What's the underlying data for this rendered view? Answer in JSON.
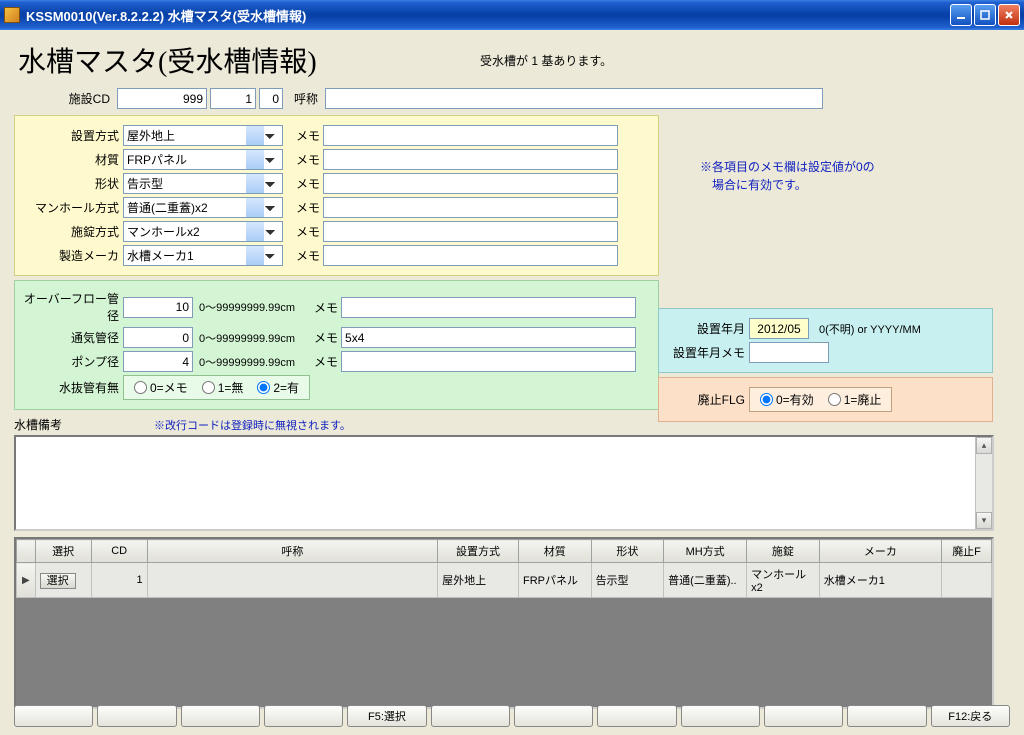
{
  "window": {
    "title": "KSSM0010(Ver.8.2.2.2) 水槽マスタ(受水槽情報)"
  },
  "page": {
    "heading": "水槽マスタ(受水槽情報)",
    "status": "受水槽が 1 基あります。"
  },
  "head": {
    "facility_cd_lbl": "施設CD",
    "facility_cd": "999",
    "sub1": "1",
    "sub2": "0",
    "name_lbl": "呼称",
    "name": ""
  },
  "note": {
    "line1": "※各項目のメモ欄は設定値が0の",
    "line2": "　場合に有効です。"
  },
  "yellow": {
    "rows": [
      {
        "label": "設置方式",
        "value": "屋外地上",
        "memo_lbl": "メモ",
        "memo": ""
      },
      {
        "label": "材質",
        "value": "FRPパネル",
        "memo_lbl": "メモ",
        "memo": ""
      },
      {
        "label": "形状",
        "value": "告示型",
        "memo_lbl": "メモ",
        "memo": ""
      },
      {
        "label": "マンホール方式",
        "value": "普通(二重蓋)x2",
        "memo_lbl": "メモ",
        "memo": ""
      },
      {
        "label": "施錠方式",
        "value": "マンホールx2",
        "memo_lbl": "メモ",
        "memo": ""
      },
      {
        "label": "製造メーカ",
        "value": "水槽メーカ1",
        "memo_lbl": "メモ",
        "memo": ""
      }
    ]
  },
  "green": {
    "rows": [
      {
        "label": "オーバーフロー管径",
        "value": "10",
        "range": "0～99999999.99cm",
        "memo_lbl": "メモ",
        "memo": ""
      },
      {
        "label": "通気管径",
        "value": "0",
        "range": "0～99999999.99cm",
        "memo_lbl": "メモ",
        "memo": "5x4"
      },
      {
        "label": "ポンプ径",
        "value": "4",
        "range": "0～99999999.99cm",
        "memo_lbl": "メモ",
        "memo": ""
      }
    ],
    "drain_lbl": "水抜管有無",
    "drain_opts": [
      "0=メモ",
      "1=無",
      "2=有"
    ],
    "drain_sel": 2
  },
  "cyan": {
    "inst_ym_lbl": "設置年月",
    "inst_ym": "2012/05",
    "inst_hint": "0(不明) or YYYY/MM",
    "inst_memo_lbl": "設置年月メモ",
    "inst_memo": ""
  },
  "orange": {
    "abolish_lbl": "廃止FLG",
    "opts": [
      "0=有効",
      "1=廃止"
    ],
    "sel": 0
  },
  "remarks": {
    "label": "水槽備考",
    "note": "※改行コードは登録時に無視されます。",
    "value": ""
  },
  "grid": {
    "cols": [
      "選択",
      "CD",
      "呼称",
      "設置方式",
      "材質",
      "形状",
      "MH方式",
      "施錠",
      "メーカ",
      "廃止F"
    ],
    "row": {
      "select": "選択",
      "cd": "1",
      "name": "",
      "install": "屋外地上",
      "material": "FRPパネル",
      "shape": "告示型",
      "mh": "普通(二重蓋)..",
      "lock": "マンホールx2",
      "maker": "水槽メーカ1",
      "abolish": ""
    }
  },
  "fkeys": [
    "",
    "",
    "",
    "",
    "F5:選択",
    "",
    "",
    "",
    "",
    "",
    "",
    "F12:戻る"
  ]
}
